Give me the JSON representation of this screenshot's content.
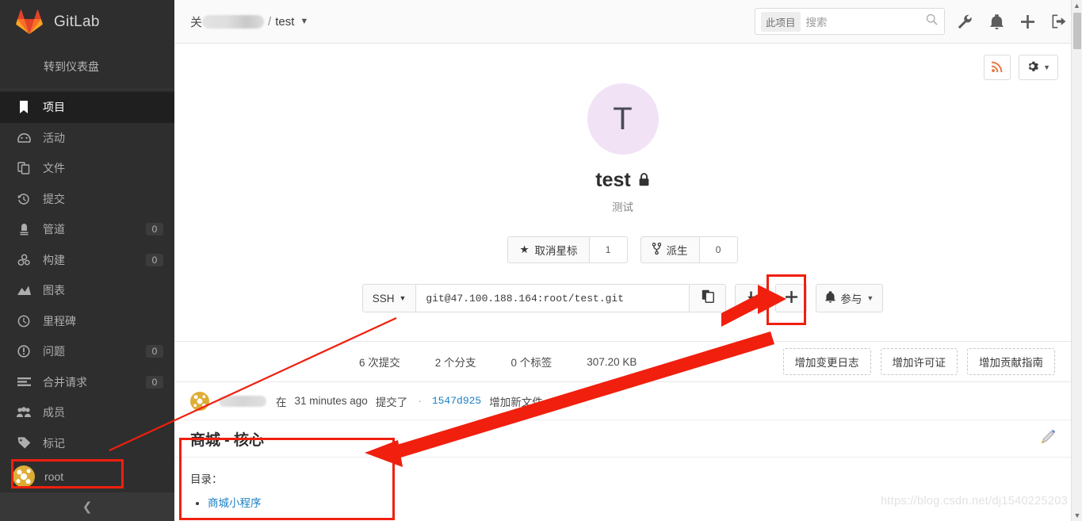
{
  "brand": {
    "name": "GitLab",
    "logo_icon": "gitlab-tanuki-logo"
  },
  "sidebar": {
    "dashboard_link": "转到仪表盘",
    "items": [
      {
        "label": "项目",
        "icon": "bookmark-icon",
        "badge": null,
        "active": true
      },
      {
        "label": "活动",
        "icon": "activity-icon",
        "badge": null,
        "active": false
      },
      {
        "label": "文件",
        "icon": "files-icon",
        "badge": null,
        "active": false
      },
      {
        "label": "提交",
        "icon": "history-icon",
        "badge": null,
        "active": false
      },
      {
        "label": "管道",
        "icon": "pipeline-icon",
        "badge": "0",
        "active": false
      },
      {
        "label": "构建",
        "icon": "build-icon",
        "badge": "0",
        "active": false
      },
      {
        "label": "图表",
        "icon": "chart-icon",
        "badge": null,
        "active": false
      },
      {
        "label": "里程碑",
        "icon": "milestone-icon",
        "badge": null,
        "active": false
      },
      {
        "label": "问题",
        "icon": "issue-icon",
        "badge": "0",
        "active": false
      },
      {
        "label": "合并请求",
        "icon": "merge-request-icon",
        "badge": "0",
        "active": false
      },
      {
        "label": "成员",
        "icon": "members-icon",
        "badge": null,
        "active": false
      },
      {
        "label": "标记",
        "icon": "label-tag-icon",
        "badge": null,
        "active": false
      }
    ],
    "user": {
      "name": "root",
      "avatar_icon": "user-identicon"
    },
    "collapse_icon": "chevron-left-icon"
  },
  "topbar": {
    "breadcrumb": {
      "group_prefix": "关",
      "group_redacted": true,
      "separator": "/",
      "project": "test",
      "caret_icon": "chevron-down-icon"
    },
    "search": {
      "scope_badge": "此项目",
      "placeholder": "搜索",
      "value": "",
      "icon": "search-icon"
    },
    "icons": [
      {
        "name": "wrench-admin-icon"
      },
      {
        "name": "bell-notification-icon"
      },
      {
        "name": "plus-new-icon"
      },
      {
        "name": "sign-out-icon"
      }
    ]
  },
  "tools": [
    {
      "name": "rss-feed-button",
      "icon": "rss-icon"
    },
    {
      "name": "project-settings-button",
      "icon": "gear-icon",
      "caret_icon": "chevron-down-icon"
    }
  ],
  "project": {
    "avatar_letter": "T",
    "avatar_bg": "#f1e3f5",
    "name": "test",
    "visibility_icon": "lock-icon",
    "description": "测试"
  },
  "actions": {
    "star": {
      "label": "取消星标",
      "icon": "star-icon",
      "count": "1"
    },
    "fork": {
      "label": "派生",
      "icon": "fork-icon",
      "count": "0"
    }
  },
  "clone": {
    "protocol": "SSH",
    "protocol_caret_icon": "chevron-down-icon",
    "url": "git@47.100.188.164:root/test.git",
    "copy_icon": "copy-clipboard-icon",
    "download_icon": "download-icon",
    "plus_label": "+",
    "notify": {
      "label": "参与",
      "icon": "bell-icon",
      "caret_icon": "chevron-down-icon"
    }
  },
  "stats": [
    {
      "label": "6 次提交"
    },
    {
      "label": "2 个分支"
    },
    {
      "label": "0 个标签"
    },
    {
      "label": "307.20 KB"
    }
  ],
  "add_buttons": [
    {
      "label": "增加变更日志"
    },
    {
      "label": "增加许可证"
    },
    {
      "label": "增加贡献指南"
    }
  ],
  "commit": {
    "author_redacted": true,
    "prefix": "在",
    "time": "31 minutes ago",
    "verb": "提交了",
    "separator": "·",
    "sha": "1547d925",
    "message": "增加新文件"
  },
  "readme": {
    "title": "商城 - 核心",
    "edit_icon": "pencil-edit-icon",
    "toc_label": "目录：",
    "links": [
      {
        "label": "商城小程序"
      }
    ]
  },
  "annotations": {
    "color": "#f01f0e",
    "boxes": [
      "plus-button-highlight",
      "readme-card-highlight",
      "sidebar-root-highlight"
    ],
    "arrows": 2
  },
  "watermark": "https://blog.csdn.net/dj1540225203"
}
